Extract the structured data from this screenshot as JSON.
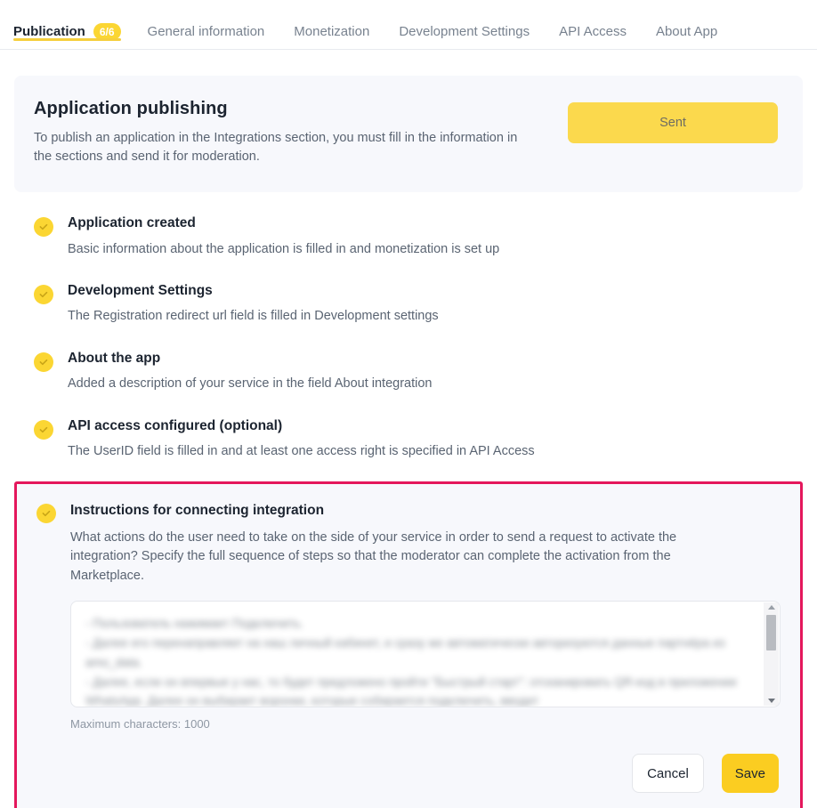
{
  "tabs": [
    {
      "label": "Publication",
      "badge": "6/6",
      "active": true
    },
    {
      "label": "General information",
      "badge": null,
      "active": false
    },
    {
      "label": "Monetization",
      "badge": null,
      "active": false
    },
    {
      "label": "Development Settings",
      "badge": null,
      "active": false
    },
    {
      "label": "API Access",
      "badge": null,
      "active": false
    },
    {
      "label": "About App",
      "badge": null,
      "active": false
    }
  ],
  "publish": {
    "title": "Application publishing",
    "description": "To publish an application in the Integrations section, you must fill in the information in the sections and send it for moderation.",
    "button_label": "Sent"
  },
  "checklist": [
    {
      "title": "Application created",
      "description": "Basic information about the application is filled in and monetization is set up",
      "status": "done"
    },
    {
      "title": "Development Settings",
      "description": "The Registration redirect url field is filled in Development settings",
      "status": "done"
    },
    {
      "title": "About the app",
      "description": "Added a description of your service in the field About integration",
      "status": "done"
    },
    {
      "title": "API access configured (optional)",
      "description": "The UserID field is filled in and at least one access right is specified in API Access",
      "status": "done"
    }
  ],
  "instructions": {
    "title": "Instructions for connecting integration",
    "description": "What actions do the user need to take on the side of your service in order to send a request to activate the integration? Specify the full sequence of steps so that the moderator can complete the activation from the Marketplace.",
    "textarea_value": "- Пользователь нажимает Подключить.\n- Далее его перенаправляет на наш личный кабинет, и сразу же автоматически авторизуются данные партнёра из amo_data.\n- Далее, если он впервые у нас, то будет предложено пройти \"Быстрый старт\": отсканировать QR-код в приложении WhatsApp. Далее он выбирает воронки, которые собирается подключить, вводит",
    "max_characters_label": "Maximum characters: 1000",
    "cancel_label": "Cancel",
    "save_label": "Save",
    "highlight_color": "#e4175c"
  },
  "theme": {
    "accent_yellow": "#fbd633",
    "save_yellow": "#fbcd21",
    "panel_background": "#f7f8fc",
    "text_primary": "#1c2430",
    "text_secondary": "#5a6472"
  }
}
